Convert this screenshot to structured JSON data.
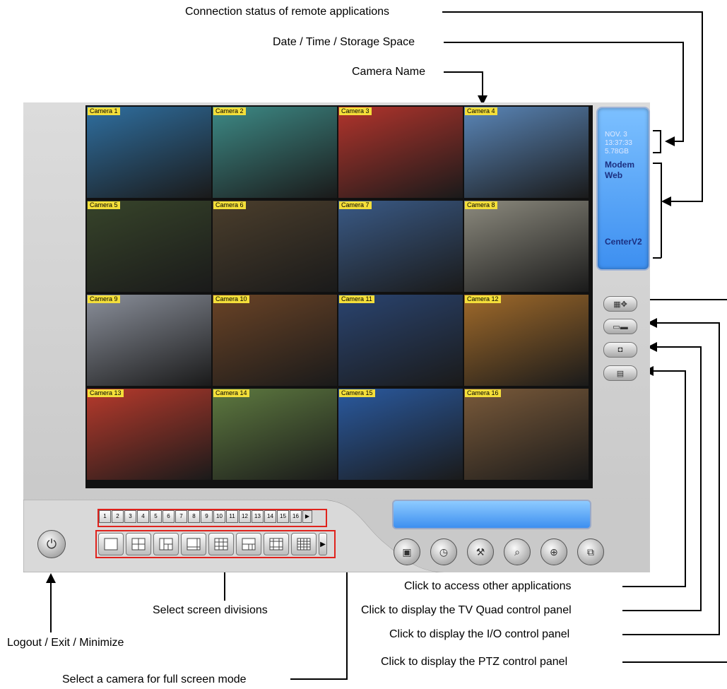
{
  "callouts": {
    "connection_status": "Connection status of remote applications",
    "date_time_storage": "Date / Time / Storage Space",
    "camera_name": "Camera Name",
    "other_apps": "Click to access other applications",
    "tv_quad": "Click to display the TV Quad control panel",
    "io_panel": "Click to display the I/O control panel",
    "ptz_panel": "Click to display the PTZ control panel",
    "screen_divisions": "Select screen divisions",
    "logout": "Logout / Exit / Minimize",
    "full_screen": "Select a camera for full screen mode"
  },
  "cameras": [
    {
      "label": "Camera 1",
      "color": "#2f6fa0"
    },
    {
      "label": "Camera 2",
      "color": "#3d8a86"
    },
    {
      "label": "Camera 3",
      "color": "#b2342c"
    },
    {
      "label": "Camera 4",
      "color": "#5a86b8"
    },
    {
      "label": "Camera 5",
      "color": "#37442a"
    },
    {
      "label": "Camera 6",
      "color": "#4b3e2c"
    },
    {
      "label": "Camera 7",
      "color": "#3a5a86"
    },
    {
      "label": "Camera 8",
      "color": "#8c8a7e"
    },
    {
      "label": "Camera 9",
      "color": "#8a8f9a"
    },
    {
      "label": "Camera 10",
      "color": "#6a4326"
    },
    {
      "label": "Camera 11",
      "color": "#2a4470"
    },
    {
      "label": "Camera 12",
      "color": "#a06a2a"
    },
    {
      "label": "Camera 13",
      "color": "#b83a2c"
    },
    {
      "label": "Camera 14",
      "color": "#5e7a40"
    },
    {
      "label": "Camera 15",
      "color": "#2a5aa0"
    },
    {
      "label": "Camera 16",
      "color": "#7a5a3a"
    }
  ],
  "info_panel": {
    "date": "NOV. 3",
    "time": "13:37:33",
    "storage": "5.78GB",
    "modem": "Modem",
    "web": "Web",
    "center": "CenterV2"
  },
  "camera_numbers": [
    "1",
    "2",
    "3",
    "4",
    "5",
    "6",
    "7",
    "8",
    "9",
    "10",
    "11",
    "12",
    "13",
    "14",
    "15",
    "16"
  ],
  "accent": {
    "red_box": "#e0221c",
    "panel_blue": "#3d8ff0"
  }
}
